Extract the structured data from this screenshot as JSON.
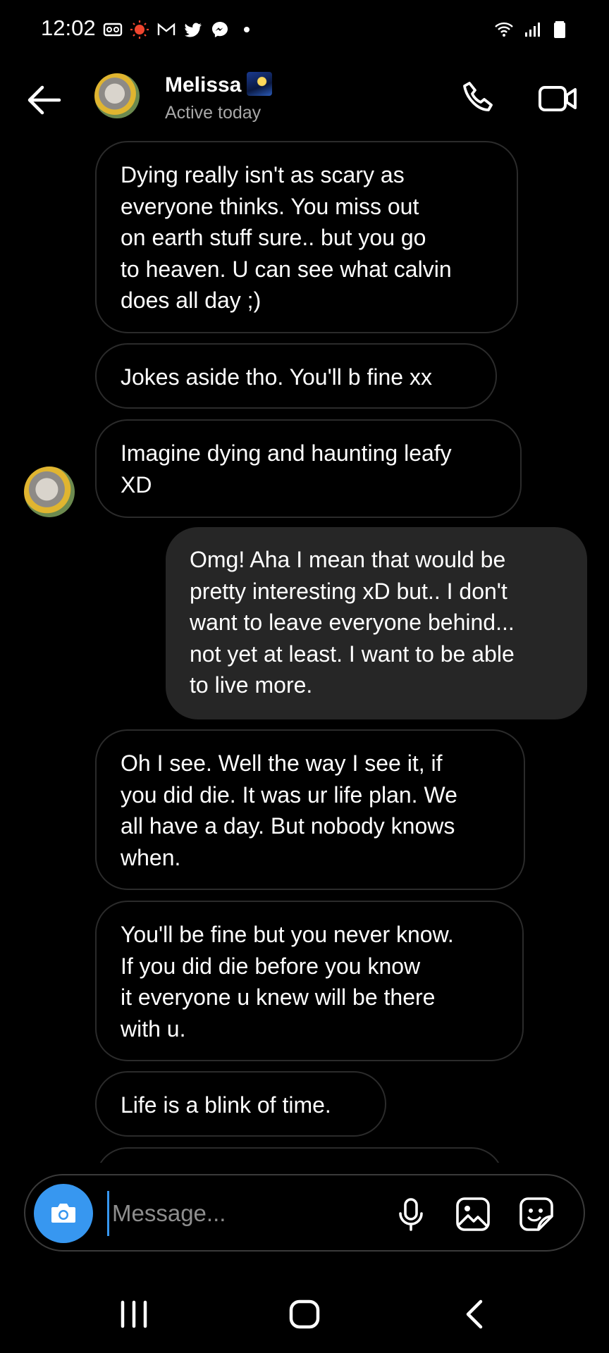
{
  "status_bar": {
    "time": "12:02",
    "left_icons": [
      "voicemail-icon",
      "record-icon",
      "gmail-icon",
      "twitter-icon",
      "messenger-icon",
      "dot-icon"
    ],
    "right_icons": [
      "wifi-icon",
      "signal-icon",
      "battery-icon"
    ]
  },
  "header": {
    "contact_name": "Melissa",
    "status": "Active today",
    "back_icon": "arrow-left-icon",
    "call_icon": "phone-icon",
    "video_icon": "video-camera-icon"
  },
  "messages": [
    {
      "direction": "incoming",
      "text": "Dying really isn't as scary as\neveryone thinks. You miss out\non earth stuff sure.. but you go\nto heaven. U can see what calvin\ndoes all day ;)"
    },
    {
      "direction": "incoming",
      "text": "Jokes aside tho. You'll b fine xx"
    },
    {
      "direction": "incoming",
      "text": "Imagine dying and haunting leafy\nXD"
    },
    {
      "direction": "outgoing",
      "text": "Omg! Aha I mean that would be\npretty interesting xD but.. I don't\nwant to leave everyone behind...\nnot yet at least. I want to be able\nto live more."
    },
    {
      "direction": "incoming",
      "text": "Oh I see. Well the way I see it, if\nyou did die. It was ur life plan. We\nall have a day. But nobody knows\nwhen."
    },
    {
      "direction": "incoming",
      "text": "You'll be fine but you never know.\nIf you did die before you know\nit everyone u knew will be there\nwith u."
    },
    {
      "direction": "incoming",
      "text": "Life is a blink of time."
    }
  ],
  "composer": {
    "placeholder": "Message...",
    "value": "",
    "icons": [
      "camera-icon",
      "microphone-icon",
      "gallery-icon",
      "sticker-icon"
    ],
    "accent_color": "#3797f0"
  },
  "nav_bar": {
    "icons": [
      "recent-apps-icon",
      "home-icon",
      "back-icon"
    ]
  },
  "colors": {
    "background": "#000000",
    "outgoing_bubble": "#262626",
    "incoming_border": "#2b2b2b",
    "secondary_text": "#a8a8a8"
  }
}
